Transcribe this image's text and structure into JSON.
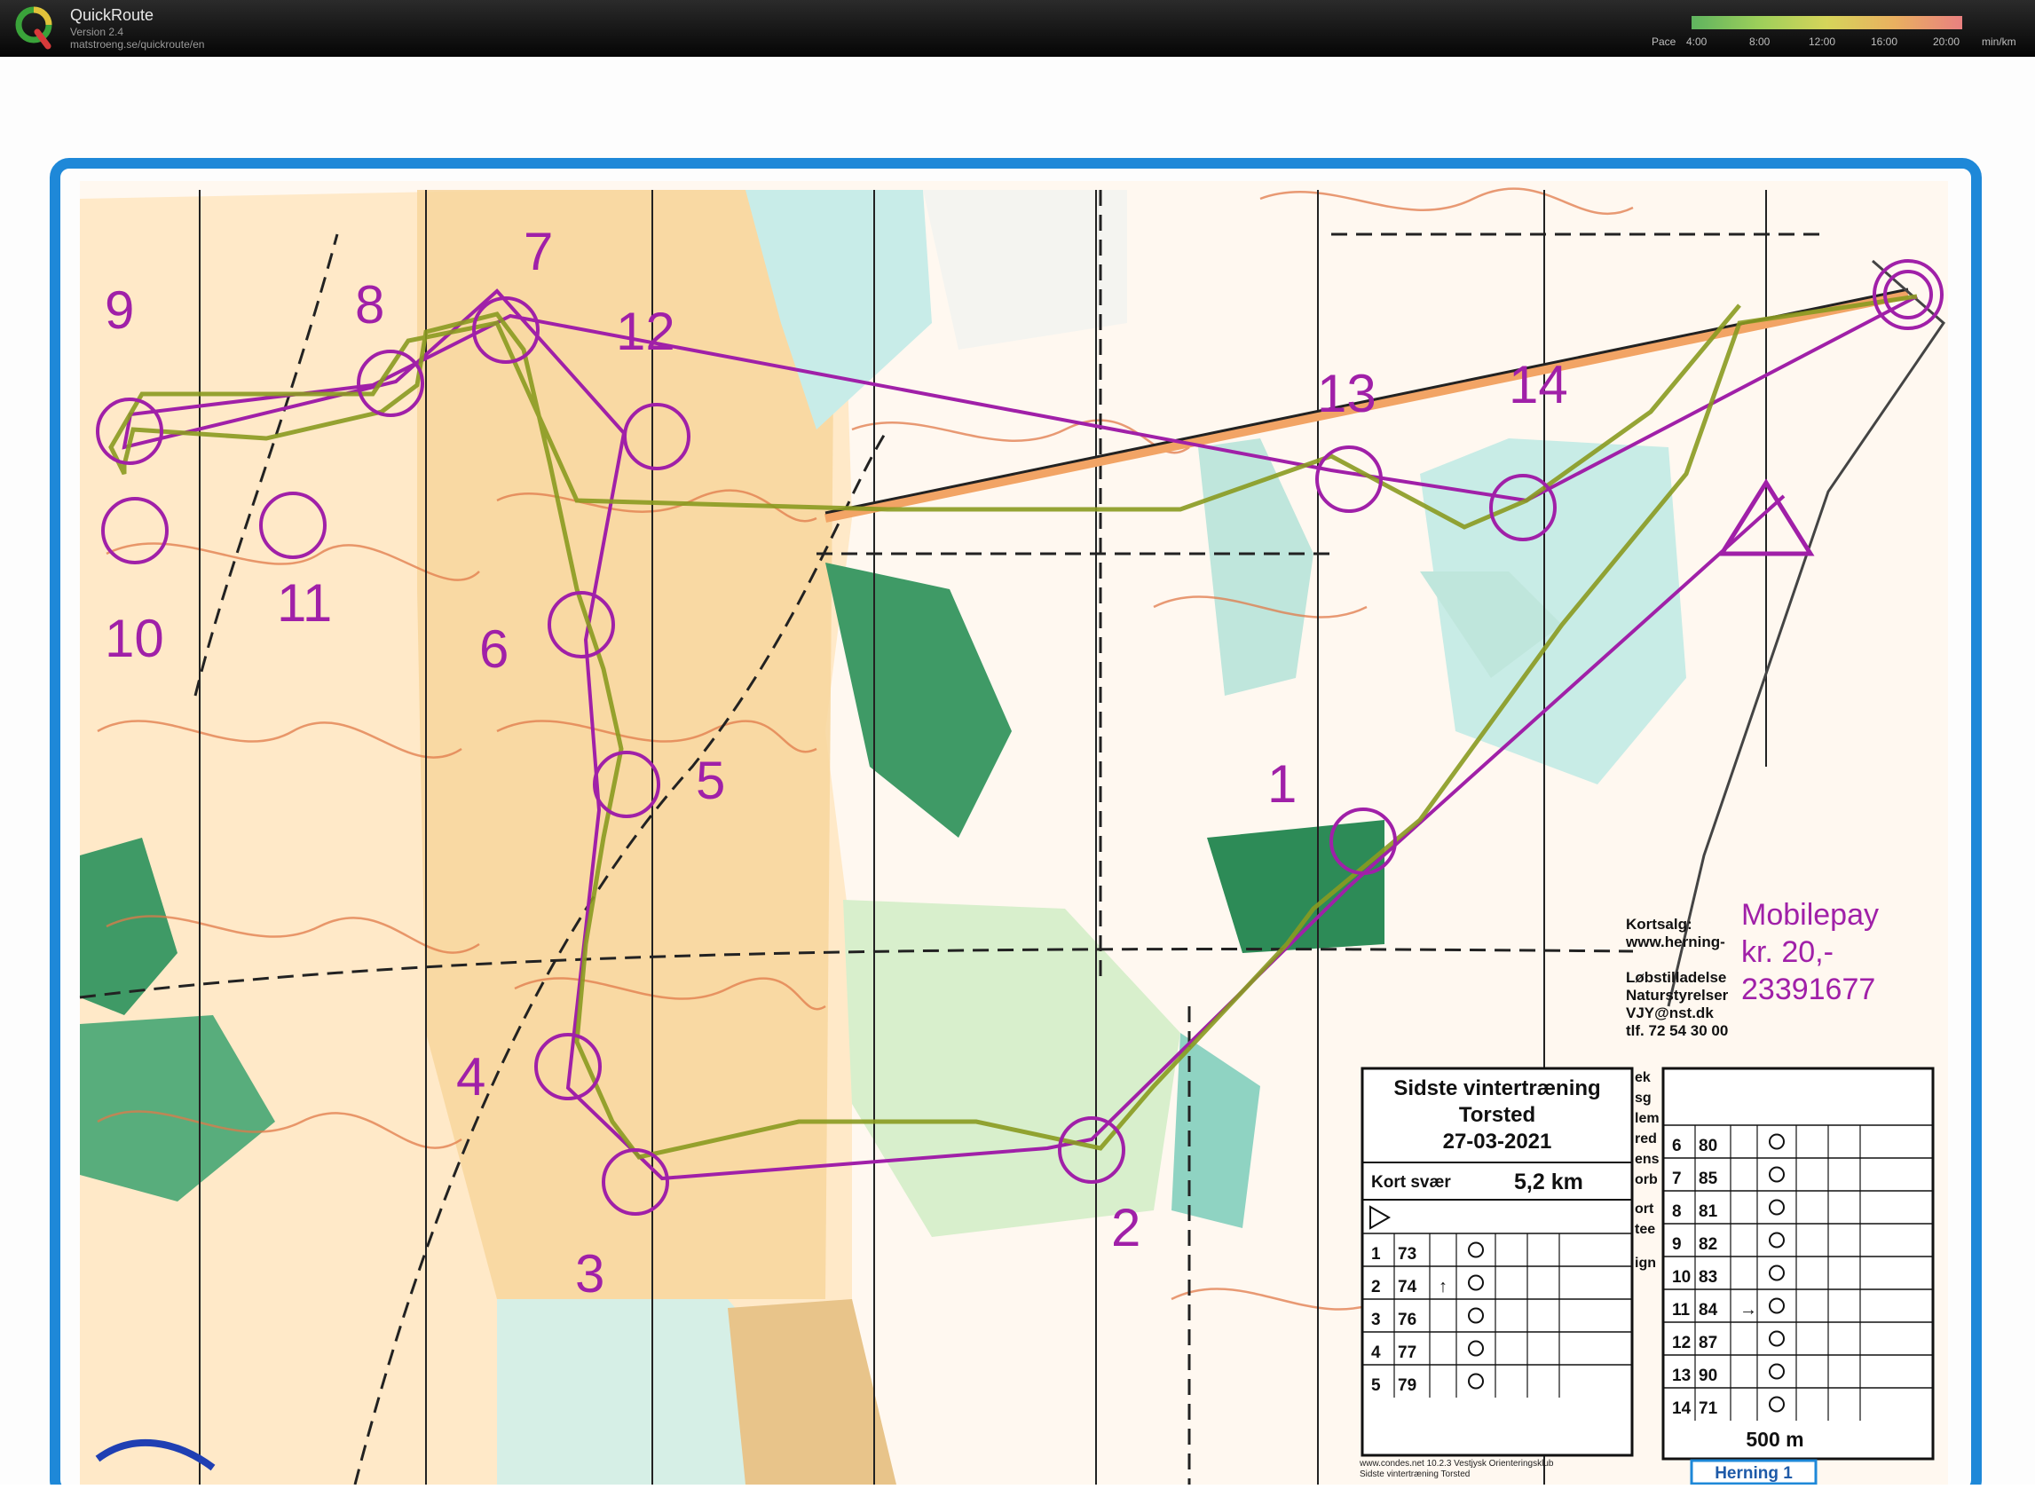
{
  "app": {
    "title": "QuickRoute",
    "version": "Version 2.4",
    "url": "matstroeng.se/quickroute/en"
  },
  "pace_legend": {
    "label": "Pace",
    "ticks": [
      "4:00",
      "8:00",
      "12:00",
      "16:00",
      "20:00"
    ],
    "unit": "min/km"
  },
  "map": {
    "controls": [
      "1",
      "2",
      "3",
      "4",
      "5",
      "6",
      "7",
      "8",
      "9",
      "10",
      "11",
      "12",
      "13",
      "14"
    ],
    "sales_lines": [
      "Kortsalg:",
      "www.herning-",
      "Løbstilladelse",
      "Naturstyrelser",
      "VJY@nst.dk",
      "tlf. 72 54 30 00"
    ],
    "mobilepay_lines": [
      "Mobilepay",
      "kr. 20,-",
      "23391677"
    ],
    "event_title": "Sidste vintertræning",
    "event_place": "Torsted",
    "event_date": "27-03-2021",
    "course_name": "Kort svær",
    "course_length": "5,2 km",
    "footer_line1": "www.condes.net 10.2.3 Vestjysk Orienteringsklub",
    "footer_line2": "Sidste vintertræning Torsted",
    "scale_label": "500 m",
    "bottom_label": "Herning 1",
    "partial_letters": [
      "ek",
      "sg",
      "lem",
      "red",
      "ens",
      "orb",
      "ort",
      "tee",
      "ign"
    ],
    "left_table": [
      {
        "n": "1",
        "code": "73",
        "dir": ""
      },
      {
        "n": "2",
        "code": "74",
        "dir": "↑"
      },
      {
        "n": "3",
        "code": "76",
        "dir": ""
      },
      {
        "n": "4",
        "code": "77",
        "dir": ""
      },
      {
        "n": "5",
        "code": "79",
        "dir": ""
      }
    ],
    "right_table": [
      {
        "n": "6",
        "code": "80",
        "dir": ""
      },
      {
        "n": "7",
        "code": "85",
        "dir": ""
      },
      {
        "n": "8",
        "code": "81",
        "dir": ""
      },
      {
        "n": "9",
        "code": "82",
        "dir": ""
      },
      {
        "n": "10",
        "code": "83",
        "dir": ""
      },
      {
        "n": "11",
        "code": "84",
        "dir": "→"
      },
      {
        "n": "12",
        "code": "87",
        "dir": ""
      },
      {
        "n": "13",
        "code": "90",
        "dir": ""
      },
      {
        "n": "14",
        "code": "71",
        "dir": ""
      }
    ]
  }
}
